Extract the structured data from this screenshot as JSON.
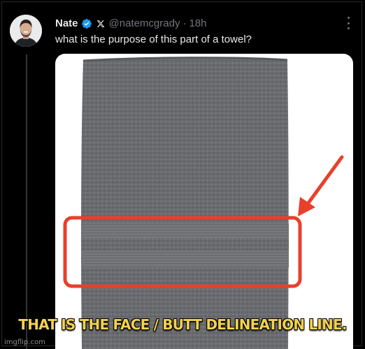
{
  "tweet": {
    "author_name": "Nate",
    "handle": "@natemcgrady",
    "separator": "·",
    "time": "18h",
    "text": "what is the purpose of this part of a towel?"
  },
  "meme": {
    "caption": "THAT IS THE FACE / BUTT DELINEATION LINE."
  },
  "watermark": "imgflip.com",
  "icons": {
    "verified": "verified-badge-icon",
    "x_logo": "x-logo-icon",
    "more": "more-options-icon",
    "arrow": "red-arrow-icon"
  },
  "colors": {
    "background": "#000000",
    "primary_text": "#e7e9ea",
    "secondary_text": "#71767b",
    "verified_blue": "#1d9bf0",
    "towel_gray": "#6b6d70",
    "highlight_red": "#e8402b",
    "caption_yellow": "#f2d24f"
  }
}
